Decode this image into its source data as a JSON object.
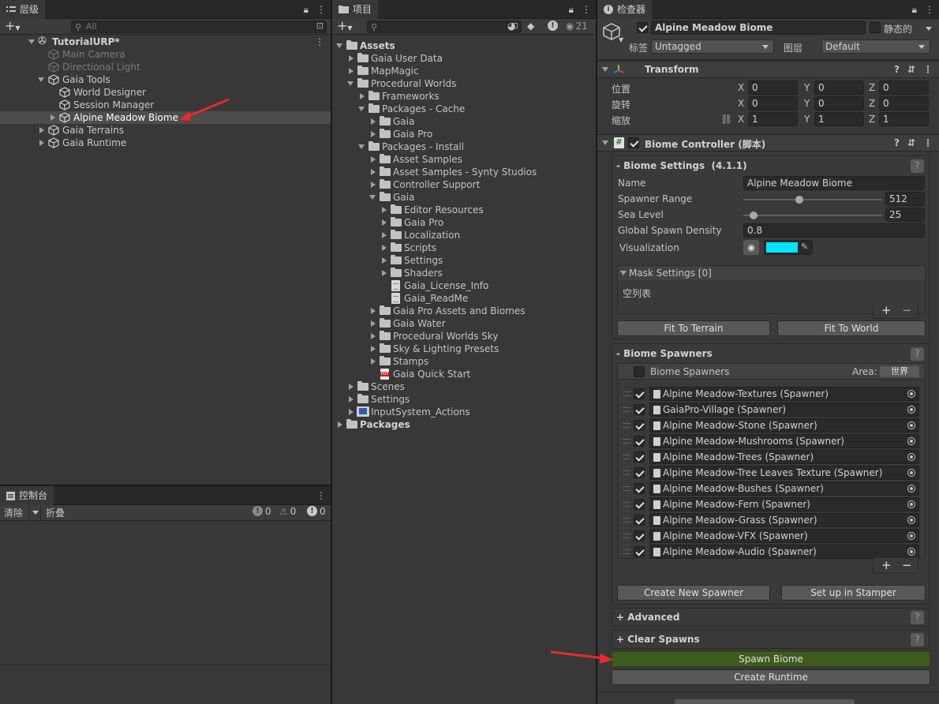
{
  "hierarchy": {
    "tab_label": "层级",
    "search_placeholder": "All",
    "scene_name": "TutorialURP*",
    "items": [
      {
        "label": "Main Camera",
        "depth": 1,
        "expand": "",
        "dim": true,
        "selected": false
      },
      {
        "label": "Directional Light",
        "depth": 1,
        "expand": "",
        "dim": true,
        "selected": false
      },
      {
        "label": "Gaia Tools",
        "depth": 1,
        "expand": "down",
        "dim": false,
        "selected": false
      },
      {
        "label": "World Designer",
        "depth": 2,
        "expand": "",
        "dim": false,
        "selected": false
      },
      {
        "label": "Session Manager",
        "depth": 2,
        "expand": "",
        "dim": false,
        "selected": false
      },
      {
        "label": "Alpine Meadow Biome",
        "depth": 2,
        "expand": "right",
        "dim": false,
        "selected": true
      },
      {
        "label": "Gaia Terrains",
        "depth": 1,
        "expand": "right",
        "dim": false,
        "selected": false
      },
      {
        "label": "Gaia Runtime",
        "depth": 1,
        "expand": "right",
        "dim": false,
        "selected": false
      }
    ]
  },
  "console": {
    "tab_label": "控制台",
    "clear_label": "清除",
    "collapse_label": "折叠",
    "info_count": "0",
    "warn_count": "0",
    "error_count": "0"
  },
  "project": {
    "tab_label": "项目",
    "hidden_count": "21",
    "items": [
      {
        "label": "Assets",
        "depth": 0,
        "expand": "down",
        "icon": "folder",
        "bold": true
      },
      {
        "label": "Gaia User Data",
        "depth": 1,
        "expand": "right",
        "icon": "folder",
        "bold": false
      },
      {
        "label": "MapMagic",
        "depth": 1,
        "expand": "right",
        "icon": "folder",
        "bold": false
      },
      {
        "label": "Procedural Worlds",
        "depth": 1,
        "expand": "down",
        "icon": "folder",
        "bold": false
      },
      {
        "label": "Frameworks",
        "depth": 2,
        "expand": "right",
        "icon": "folder",
        "bold": false
      },
      {
        "label": "Packages - Cache",
        "depth": 2,
        "expand": "down",
        "icon": "folder",
        "bold": false
      },
      {
        "label": "Gaia",
        "depth": 3,
        "expand": "right",
        "icon": "folder",
        "bold": false
      },
      {
        "label": "Gaia Pro",
        "depth": 3,
        "expand": "right",
        "icon": "folder",
        "bold": false
      },
      {
        "label": "Packages - Install",
        "depth": 2,
        "expand": "down",
        "icon": "folder",
        "bold": false
      },
      {
        "label": "Asset Samples",
        "depth": 3,
        "expand": "right",
        "icon": "folder",
        "bold": false
      },
      {
        "label": "Asset Samples - Synty Studios",
        "depth": 3,
        "expand": "right",
        "icon": "folder",
        "bold": false
      },
      {
        "label": "Controller Support",
        "depth": 3,
        "expand": "right",
        "icon": "folder",
        "bold": false
      },
      {
        "label": "Gaia",
        "depth": 3,
        "expand": "down",
        "icon": "folder",
        "bold": false
      },
      {
        "label": "Editor Resources",
        "depth": 4,
        "expand": "right",
        "icon": "folder",
        "bold": false
      },
      {
        "label": "Gaia Pro",
        "depth": 4,
        "expand": "right",
        "icon": "folder",
        "bold": false
      },
      {
        "label": "Localization",
        "depth": 4,
        "expand": "right",
        "icon": "folder",
        "bold": false
      },
      {
        "label": "Scripts",
        "depth": 4,
        "expand": "right",
        "icon": "folder",
        "bold": false
      },
      {
        "label": "Settings",
        "depth": 4,
        "expand": "right",
        "icon": "folder",
        "bold": false
      },
      {
        "label": "Shaders",
        "depth": 4,
        "expand": "right",
        "icon": "folder",
        "bold": false
      },
      {
        "label": "Gaia_License_Info",
        "depth": 4,
        "expand": "",
        "icon": "doc",
        "bold": false
      },
      {
        "label": "Gaia_ReadMe",
        "depth": 4,
        "expand": "",
        "icon": "doc",
        "bold": false
      },
      {
        "label": "Gaia Pro Assets and Biomes",
        "depth": 3,
        "expand": "right",
        "icon": "folder",
        "bold": false
      },
      {
        "label": "Gaia Water",
        "depth": 3,
        "expand": "right",
        "icon": "folder",
        "bold": false
      },
      {
        "label": "Procedural Worlds Sky",
        "depth": 3,
        "expand": "right",
        "icon": "folder",
        "bold": false
      },
      {
        "label": "Sky & Lighting Presets",
        "depth": 3,
        "expand": "right",
        "icon": "folder",
        "bold": false
      },
      {
        "label": "Stamps",
        "depth": 3,
        "expand": "right",
        "icon": "folder",
        "bold": false
      },
      {
        "label": "Gaia Quick Start",
        "depth": 3,
        "expand": "",
        "icon": "pdf",
        "bold": false
      },
      {
        "label": "Scenes",
        "depth": 1,
        "expand": "right",
        "icon": "folder",
        "bold": false
      },
      {
        "label": "Settings",
        "depth": 1,
        "expand": "right",
        "icon": "folder",
        "bold": false
      },
      {
        "label": "InputSystem_Actions",
        "depth": 1,
        "expand": "right",
        "icon": "input",
        "bold": false
      },
      {
        "label": "Packages",
        "depth": 0,
        "expand": "right",
        "icon": "folder",
        "bold": true
      }
    ]
  },
  "inspector": {
    "tab_label": "检查器",
    "object_name": "Alpine Meadow Biome",
    "static_label": "静态的",
    "tag_label": "标签",
    "tag_value": "Untagged",
    "layer_label": "图层",
    "layer_value": "Default",
    "transform": {
      "title": "Transform",
      "position_label": "位置",
      "rotation_label": "旋转",
      "scale_label": "缩放",
      "x": "X",
      "y": "Y",
      "z": "Z",
      "position": [
        "0",
        "0",
        "0"
      ],
      "rotation": [
        "0",
        "0",
        "0"
      ],
      "scale": [
        "1",
        "1",
        "1"
      ]
    },
    "biome_controller": {
      "title": "Biome Controller (脚本)",
      "settings_header": "- Biome Settings",
      "version": "(4.1.1)",
      "name_label": "Name",
      "name_value": "Alpine Meadow Biome",
      "spawner_range_label": "Spawner Range",
      "spawner_range_value": "512",
      "spawner_range_fraction": 0.4,
      "sea_level_label": "Sea Level",
      "sea_level_value": "25",
      "sea_level_fraction": 0.05,
      "density_label": "Global Spawn Density",
      "density_value": "0.8",
      "visualization_label": "Visualization",
      "visualization_color": "#00e5ff",
      "mask_header": "Mask Settings [0]",
      "mask_empty": "空列表",
      "fit_terrain": "Fit To Terrain",
      "fit_world": "Fit To World",
      "spawners_header": "- Biome Spawners",
      "spawners_list_label": "Biome Spawners",
      "area_label": "Area:",
      "area_value": "世界",
      "spawners": [
        "Alpine Meadow-Textures (Spawner)",
        "GaiaPro-Village (Spawner)",
        "Alpine Meadow-Stone (Spawner)",
        "Alpine Meadow-Mushrooms (Spawner)",
        "Alpine Meadow-Trees (Spawner)",
        "Alpine Meadow-Tree Leaves Texture (Spawner)",
        "Alpine Meadow-Bushes (Spawner)",
        "Alpine Meadow-Fern (Spawner)",
        "Alpine Meadow-Grass (Spawner)",
        "Alpine Meadow-VFX (Spawner)",
        "Alpine Meadow-Audio (Spawner)"
      ],
      "create_spawner": "Create New Spawner",
      "setup_stamper": "Set up in Stamper",
      "advanced": "+ Advanced",
      "clear_spawns": "+ Clear Spawns",
      "spawn_biome": "Spawn Biome",
      "create_runtime": "Create Runtime",
      "help": "?",
      "plus": "+",
      "minus": "−"
    }
  },
  "colors": {
    "annotation_arrow": "#e8292a",
    "spawn_button": "#3d5c1e",
    "selection": "#4d4d4d"
  }
}
